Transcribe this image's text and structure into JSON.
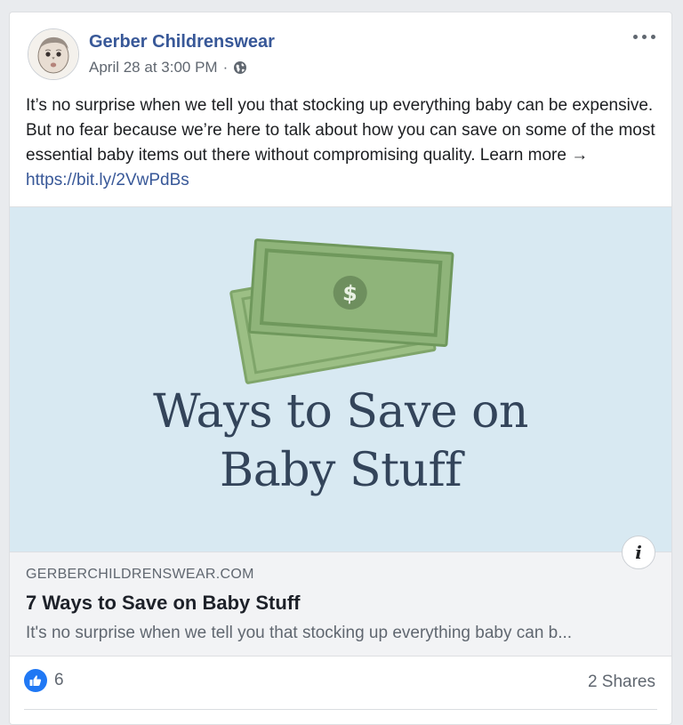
{
  "post": {
    "page_name": "Gerber Childrenswear",
    "timestamp": "April 28 at 3:00 PM",
    "separator": "·",
    "privacy_icon": "globe-icon",
    "text": "It’s no surprise when we tell you that stocking up everything baby can be expensive. But no fear because we’re here to talk about how you can save on some of the most essential baby items out there without compromising quality. Learn more → ",
    "link_text": "https://bit.ly/2VwPdBs"
  },
  "link_preview": {
    "image_title_line1": "Ways to Save on",
    "image_title_line2": "Baby Stuff",
    "image_bill_symbol": "$",
    "domain": "GERBERCHILDRENSWEAR.COM",
    "title": "7 Ways to Save on Baby Stuff",
    "description": "It's no surprise when we tell you that stocking up everything baby can b...",
    "info_label": "i"
  },
  "footer": {
    "reaction_count": "6",
    "shares": "2 Shares"
  },
  "colors": {
    "link_blue": "#385898",
    "like_blue": "#2078f4",
    "image_bg": "#d8e9f2",
    "bill_green": "#8fb47a",
    "title_text": "#33445a"
  }
}
